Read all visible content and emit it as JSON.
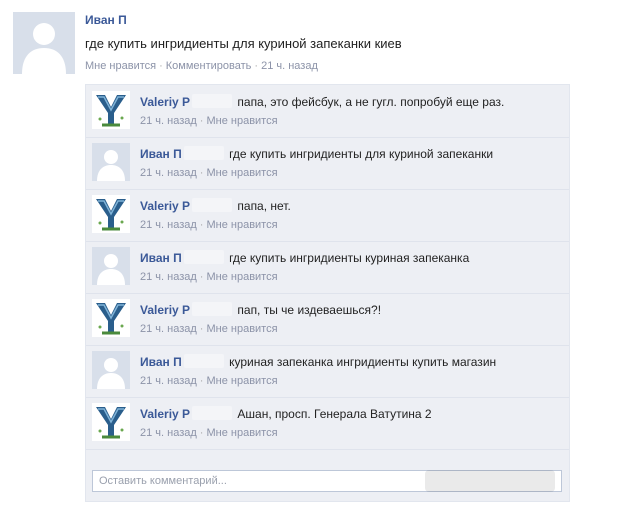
{
  "post": {
    "author": "Иван П",
    "text": "где купить ингридиенты для куриной запеканки киев",
    "like": "Мне нравится",
    "separator": "·",
    "comment": "Комментировать",
    "time": "21 ч. назад"
  },
  "comments": [
    {
      "author": "Valeriy P",
      "text": "папа, это фейсбук, а не гугл. попробуй еще раз.",
      "time": "21 ч. назад",
      "like": "Мне нравится",
      "avatar": "logo-y-icon"
    },
    {
      "author": "Иван П",
      "text": "где купить ингридиенты для куриной запеканки",
      "time": "21 ч. назад",
      "like": "Мне нравится",
      "avatar": "default-avatar-icon"
    },
    {
      "author": "Valeriy P",
      "text": "папа, нет.",
      "time": "21 ч. назад",
      "like": "Мне нравится",
      "avatar": "logo-y-icon"
    },
    {
      "author": "Иван П",
      "text": "где купить ингридиенты куриная запеканка",
      "time": "21 ч. назад",
      "like": "Мне нравится",
      "avatar": "default-avatar-icon"
    },
    {
      "author": "Valeriy P",
      "text": "пап, ты че издеваешься?!",
      "time": "21 ч. назад",
      "like": "Мне нравится",
      "avatar": "logo-y-icon"
    },
    {
      "author": "Иван П",
      "text": "куриная запеканка ингридиенты купить магазин",
      "time": "21 ч. назад",
      "like": "Мне нравится",
      "avatar": "default-avatar-icon"
    },
    {
      "author": "Valeriy P",
      "text": "Ашан, просп. Генерала Ватутина 2",
      "time": "21 ч. назад",
      "like": "Мне нравится",
      "avatar": "logo-y-icon"
    }
  ],
  "comment_input": {
    "placeholder": "Оставить комментарий..."
  },
  "colors": {
    "link": "#3b5998",
    "meta": "#8c93a8",
    "thread_bg": "#edeff4",
    "avatar_bg": "#d8dfea"
  }
}
